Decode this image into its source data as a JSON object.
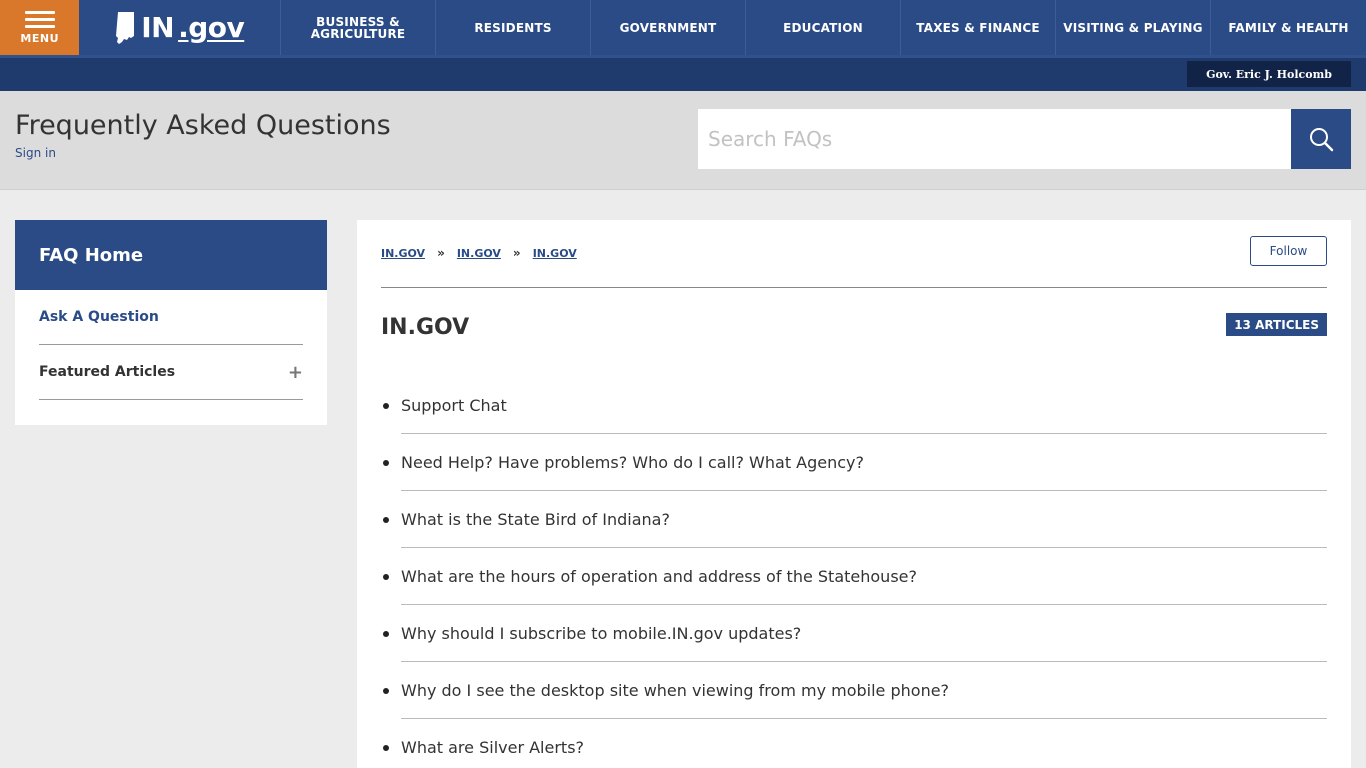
{
  "topnav": {
    "menu_label": "MENU",
    "logo_text": "IN",
    "logo_suffix": ".gov",
    "items": [
      {
        "line1": "BUSINESS &",
        "line2": "AGRICULTURE"
      },
      {
        "line1": "RESIDENTS",
        "line2": ""
      },
      {
        "line1": "GOVERNMENT",
        "line2": ""
      },
      {
        "line1": "EDUCATION",
        "line2": ""
      },
      {
        "line1": "TAXES & FINANCE",
        "line2": ""
      },
      {
        "line1": "VISITING & PLAYING",
        "line2": ""
      },
      {
        "line1": "FAMILY & HEALTH",
        "line2": ""
      }
    ]
  },
  "subbar": {
    "governor": "Gov. Eric J. Holcomb"
  },
  "header": {
    "title": "Frequently Asked Questions",
    "signin": "Sign in",
    "search_placeholder": "Search FAQs"
  },
  "sidebar": {
    "home": "FAQ Home",
    "ask": "Ask A Question",
    "featured": "Featured Articles"
  },
  "main": {
    "breadcrumbs": [
      "IN.GOV",
      "IN.GOV",
      "IN.GOV"
    ],
    "separator": "»",
    "follow": "Follow",
    "title": "IN.GOV",
    "count": "13 ARTICLES",
    "articles": [
      "Support Chat",
      "Need Help? Have problems? Who do I call? What Agency?",
      "What is the State Bird of Indiana?",
      "What are the hours of operation and address of the Statehouse?",
      "Why should I subscribe to mobile.IN.gov updates?",
      "Why do I see the desktop site when viewing from my mobile phone?",
      "What are Silver Alerts?"
    ]
  },
  "colors": {
    "brand_blue": "#2a4b86",
    "menu_orange": "#d9772a",
    "subbar_blue": "#1f3b6e"
  }
}
